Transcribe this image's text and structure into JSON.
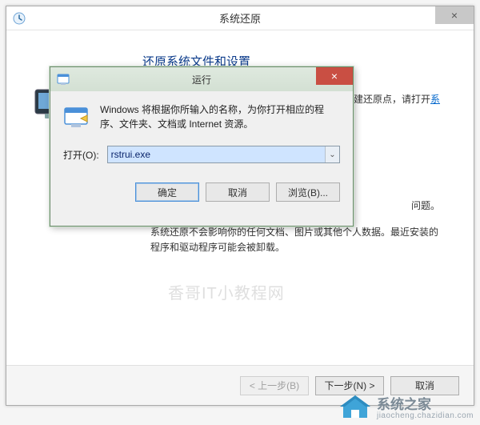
{
  "sysrestore": {
    "title": "系统还原",
    "heading": "还原系统文件和设置",
    "tip_tail": "创建还原点，请打开",
    "tip_link": "系",
    "issue_tail": "问题。",
    "note": "系统还原不会影响你的任何文档、图片或其他个人数据。最近安装的程序和驱动程序可能会被卸载。",
    "back_btn": "< 上一步(B)",
    "next_btn": "下一步(N) >",
    "cancel_btn": "取消",
    "close_glyph": "×"
  },
  "run": {
    "title": "运行",
    "close_glyph": "×",
    "desc": "Windows 将根据你所输入的名称，为你打开相应的程序、文件夹、文档或 Internet 资源。",
    "open_label": "打开(O):",
    "value": "rstrui.exe",
    "dropdown_glyph": "⌄",
    "ok_btn": "确定",
    "cancel_btn": "取消",
    "browse_btn": "浏览(B)..."
  },
  "watermark": {
    "text": "香哥IT小教程网",
    "brand": "系统之家",
    "url": "jiaocheng.chazidian.com"
  }
}
